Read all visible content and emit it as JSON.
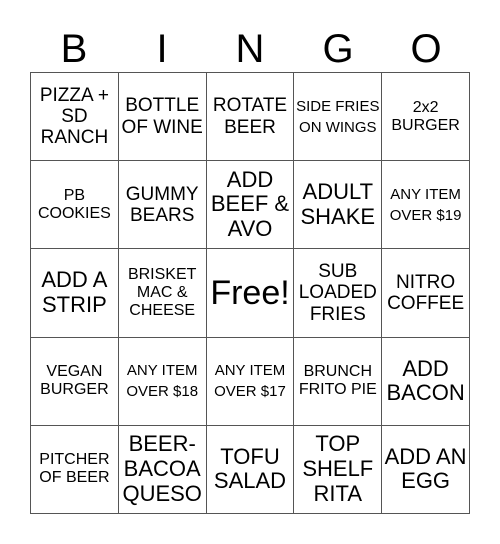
{
  "header": {
    "letters": [
      "B",
      "I",
      "N",
      "G",
      "O"
    ]
  },
  "cells": [
    {
      "text": "PIZZA + SD RANCH",
      "size": "m"
    },
    {
      "text": "BOTTLE OF WINE",
      "size": "m"
    },
    {
      "text": "ROTATE BEER",
      "size": "m"
    },
    {
      "text": "SIDE FRIES ON WINGS",
      "size": "xs"
    },
    {
      "text": "2x2 BURGER",
      "size": "s"
    },
    {
      "text": "PB COOKIES",
      "size": "s"
    },
    {
      "text": "GUMMY BEARS",
      "size": "m"
    },
    {
      "text": "ADD BEEF & AVO",
      "size": "l"
    },
    {
      "text": "ADULT SHAKE",
      "size": "l"
    },
    {
      "text": "ANY ITEM OVER $19",
      "size": "xs"
    },
    {
      "text": "ADD A STRIP",
      "size": "l"
    },
    {
      "text": "BRISKET MAC & CHEESE",
      "size": "s"
    },
    {
      "text": "Free!",
      "size": "xl"
    },
    {
      "text": "SUB LOADED FRIES",
      "size": "m"
    },
    {
      "text": "NITRO COFFEE",
      "size": "m"
    },
    {
      "text": "VEGAN BURGER",
      "size": "s"
    },
    {
      "text": "ANY ITEM OVER $18",
      "size": "xs"
    },
    {
      "text": "ANY ITEM OVER $17",
      "size": "xs"
    },
    {
      "text": "BRUNCH FRITO PIE",
      "size": "s"
    },
    {
      "text": "ADD BACON",
      "size": "l"
    },
    {
      "text": "PITCHER OF BEER",
      "size": "s"
    },
    {
      "text": "BEER-BACOA QUESO",
      "size": "l"
    },
    {
      "text": "TOFU SALAD",
      "size": "l"
    },
    {
      "text": "TOP SHELF RITA",
      "size": "l"
    },
    {
      "text": "ADD AN EGG",
      "size": "l"
    }
  ],
  "colors": {
    "background": "#ffffff",
    "text": "#000000",
    "grid_line": "#555555"
  }
}
